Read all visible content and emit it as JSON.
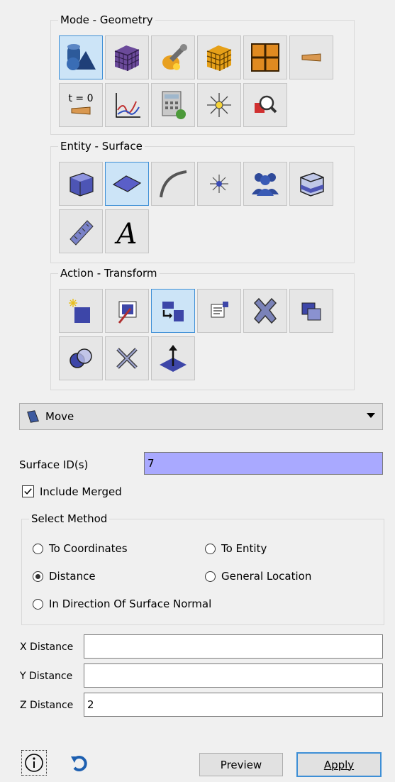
{
  "groups": {
    "mode": {
      "title": "Mode - Geometry"
    },
    "entity": {
      "title": "Entity - Surface"
    },
    "action": {
      "title": "Action - Transform"
    }
  },
  "mode_buttons": [
    {
      "name": "geometry-mode-icon",
      "active": true
    },
    {
      "name": "mesh-mode-icon"
    },
    {
      "name": "boundary-conditions-icon"
    },
    {
      "name": "blocks-mode-icon"
    },
    {
      "name": "grid-mode-icon"
    },
    {
      "name": "material-icon"
    },
    {
      "name": "time-zero-icon",
      "text": "t = 0"
    },
    {
      "name": "plot-graph-icon"
    },
    {
      "name": "calculator-icon"
    },
    {
      "name": "analysis-star-icon"
    },
    {
      "name": "magnify-inspect-icon"
    }
  ],
  "entity_buttons": [
    {
      "name": "volume-icon"
    },
    {
      "name": "surface-icon",
      "active": true
    },
    {
      "name": "curve-icon"
    },
    {
      "name": "vertex-icon"
    },
    {
      "name": "group-icon"
    },
    {
      "name": "body-icon"
    },
    {
      "name": "measure-ruler-icon"
    },
    {
      "name": "text-annotation-icon",
      "text": "A"
    }
  ],
  "action_buttons": [
    {
      "name": "create-icon"
    },
    {
      "name": "modify-icon"
    },
    {
      "name": "transform-icon",
      "active": true
    },
    {
      "name": "properties-icon"
    },
    {
      "name": "delete-icon"
    },
    {
      "name": "copy-icon"
    },
    {
      "name": "boolean-icon"
    },
    {
      "name": "webcut-icon"
    },
    {
      "name": "imprint-icon"
    }
  ],
  "operation": {
    "label": "Move",
    "icon": "surface-move-icon"
  },
  "surface_ids": {
    "label": "Surface ID(s)",
    "value": "7"
  },
  "include_merged": {
    "label": "Include Merged",
    "checked": true
  },
  "select_method": {
    "title": "Select Method",
    "options": [
      {
        "label": "To Coordinates",
        "selected": false
      },
      {
        "label": "To Entity",
        "selected": false
      },
      {
        "label": "Distance",
        "selected": true
      },
      {
        "label": "General Location",
        "selected": false
      },
      {
        "label": "In Direction Of Surface Normal",
        "selected": false
      }
    ]
  },
  "distances": [
    {
      "label": "X Distance",
      "value": ""
    },
    {
      "label": "Y Distance",
      "value": ""
    },
    {
      "label": "Z Distance",
      "value": "2"
    }
  ],
  "footer": {
    "info_icon": "info-icon",
    "reset_icon": "reset-icon",
    "preview_label": "Preview",
    "apply_label": "Apply"
  },
  "colors": {
    "accent": "#3e8fd6",
    "selection": "#a9a9ff"
  }
}
